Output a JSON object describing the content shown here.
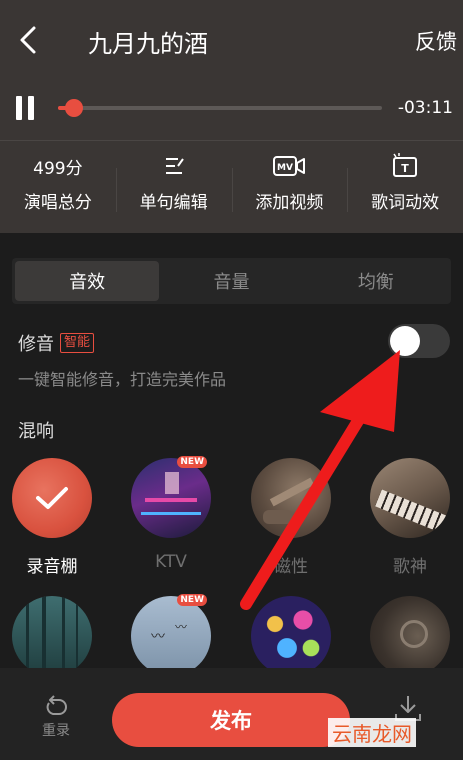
{
  "header": {
    "title": "九月九的酒",
    "feedback_label": "反馈",
    "back_icon": "chevron-left-icon"
  },
  "player": {
    "progress_fraction": 0.05,
    "time_remaining": "-03:11",
    "accent_color": "#e84e40"
  },
  "tools": [
    {
      "top": "499分",
      "label": "演唱总分",
      "icon": "score-text"
    },
    {
      "top": "",
      "label": "单句编辑",
      "icon": "edit-lines-icon"
    },
    {
      "top": "",
      "label": "添加视频",
      "icon": "mv-camera-icon"
    },
    {
      "top": "",
      "label": "歌词动效",
      "icon": "lyrics-effect-icon"
    }
  ],
  "tabs": [
    {
      "label": "音效",
      "active": true
    },
    {
      "label": "音量",
      "active": false
    },
    {
      "label": "均衡",
      "active": false
    }
  ],
  "xiuyin": {
    "label": "修音",
    "badge": "智能",
    "description": "一键智能修音，打造完美作品",
    "enabled": false
  },
  "reverb": {
    "title": "混响",
    "new_badge": "NEW",
    "effects": [
      {
        "name": "录音棚",
        "selected": true,
        "is_new": false
      },
      {
        "name": "KTV",
        "selected": false,
        "is_new": true
      },
      {
        "name": "磁性",
        "selected": false,
        "is_new": false
      },
      {
        "name": "歌神",
        "selected": false,
        "is_new": false
      },
      {
        "name": "",
        "selected": false,
        "is_new": false
      },
      {
        "name": "",
        "selected": false,
        "is_new": true
      },
      {
        "name": "",
        "selected": false,
        "is_new": false
      },
      {
        "name": "",
        "selected": false,
        "is_new": false
      }
    ]
  },
  "bottom": {
    "redo_label": "重录",
    "publish_label": "发布",
    "download_icon": "download-icon"
  },
  "watermark": "云南龙网"
}
